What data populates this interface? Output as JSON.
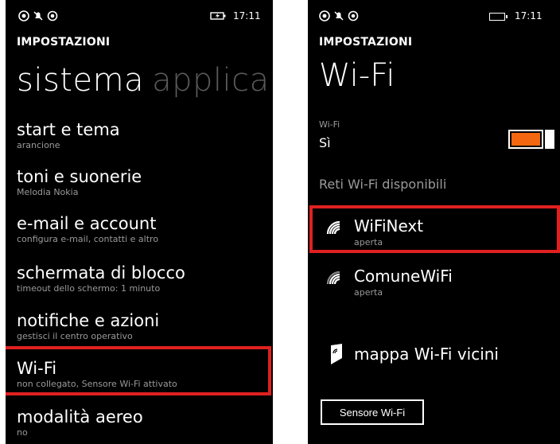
{
  "left": {
    "status": {
      "time": "17:11",
      "icons": [
        "signal-icon",
        "notification-off-icon",
        "location-icon",
        "charging-battery-icon"
      ]
    },
    "app_title": "IMPOSTAZIONI",
    "pivot": {
      "active": "sistema",
      "next": "applica"
    },
    "items": [
      {
        "title": "start e tema",
        "subtitle": "arancione"
      },
      {
        "title": "toni e suonerie",
        "subtitle": "Melodia Nokia"
      },
      {
        "title": "e-mail e account",
        "subtitle": "configura e-mail, contatti e altro"
      },
      {
        "title": "schermata di blocco",
        "subtitle": "timeout dello schermo: 1 minuto"
      },
      {
        "title": "notifiche e azioni",
        "subtitle": "gestisci il centro operativo"
      },
      {
        "title": "Wi-Fi",
        "subtitle": "non collegato, Sensore Wi-Fi attivato"
      },
      {
        "title": "modalità aereo",
        "subtitle": "no"
      }
    ]
  },
  "right": {
    "status": {
      "time": "17:11",
      "icons": [
        "signal-icon",
        "notification-off-icon",
        "location-icon",
        "battery-icon"
      ]
    },
    "app_title": "IMPOSTAZIONI",
    "page_title": "Wi-Fi",
    "wifi_label": "Wi-Fi",
    "wifi_state": "Sì",
    "toggle_on": true,
    "accent": "#f2670f",
    "section": "Reti Wi-Fi disponibili",
    "networks": [
      {
        "name": "WiFiNext",
        "status": "aperta"
      },
      {
        "name": "ComuneWiFi",
        "status": "aperta"
      }
    ],
    "map_link": "mappa Wi-Fi vicini",
    "sensor_button": "Sensore Wi-Fi"
  }
}
